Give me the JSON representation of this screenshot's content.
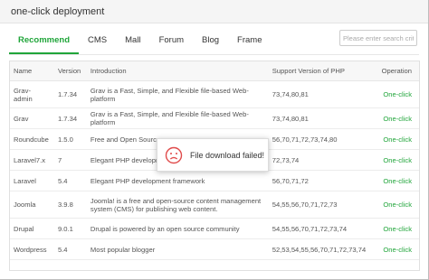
{
  "dialog": {
    "title": "one-click deployment"
  },
  "tabs": [
    {
      "label": "Recommend",
      "active": true
    },
    {
      "label": "CMS"
    },
    {
      "label": "Mall"
    },
    {
      "label": "Forum"
    },
    {
      "label": "Blog"
    },
    {
      "label": "Frame"
    }
  ],
  "search": {
    "placeholder": "Please enter search criteria"
  },
  "table": {
    "headers": [
      "Name",
      "Version",
      "Introduction",
      "Support Version of PHP",
      "Operation"
    ],
    "rows": [
      {
        "name": "Grav-\nadmin",
        "version": "1.7.34",
        "intro": "Grav is a Fast, Simple, and Flexible file-based Web-platform",
        "php": "73,74,80,81",
        "op": "One-click"
      },
      {
        "name": "Grav",
        "version": "1.7.34",
        "intro": "Grav is a Fast, Simple, and Flexible file-based Web-platform",
        "php": "73,74,80,81",
        "op": "One-click"
      },
      {
        "name": "Roundcube",
        "version": "1.5.0",
        "intro": "Free and Open Source",
        "php": "56,70,71,72,73,74,80",
        "op": "One-click"
      },
      {
        "name": "Laravel7.x",
        "version": "7",
        "intro": "Elegant PHP developm",
        "php": "72,73,74",
        "op": "One-click"
      },
      {
        "name": "Laravel",
        "version": "5.4",
        "intro": "Elegant PHP development framework",
        "php": "56,70,71,72",
        "op": "One-click"
      },
      {
        "name": "Joomla",
        "version": "3.9.8",
        "intro": "Joomla! is a free and open-source content management\nsystem (CMS) for publishing web content.",
        "php": "54,55,56,70,71,72,73",
        "op": "One-click"
      },
      {
        "name": "Drupal",
        "version": "9.0.1",
        "intro": "Drupal is powered by an open source community",
        "php": "54,55,56,70,71,72,73,74",
        "op": "One-click"
      },
      {
        "name": "Wordpress",
        "version": "5.4",
        "intro": "Most popular blogger",
        "php": "52,53,54,55,56,70,71,72,73,74",
        "op": "One-click"
      }
    ]
  },
  "toast": {
    "message": "File download failed!",
    "icon": "sad-face-icon",
    "color": "#e04b4b"
  }
}
